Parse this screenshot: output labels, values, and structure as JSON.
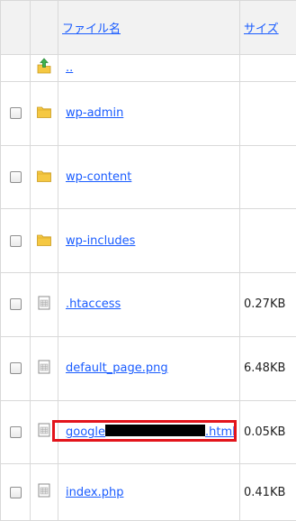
{
  "table": {
    "header": {
      "filename_label": "ファイル名",
      "size_label": "サイズ"
    },
    "up_link": "..",
    "rows": [
      {
        "name": "wp-admin",
        "type": "folder",
        "size": ""
      },
      {
        "name": "wp-content",
        "type": "folder",
        "size": ""
      },
      {
        "name": "wp-includes",
        "type": "folder",
        "size": ""
      },
      {
        "name": ".htaccess",
        "type": "file",
        "size": "0.27KB"
      },
      {
        "name": "default_page.png",
        "type": "file",
        "size": "6.48KB"
      },
      {
        "name_prefix": "google",
        "name_suffix": ".html",
        "type": "file",
        "size": "0.05KB",
        "highlighted": true
      },
      {
        "name": "index.php",
        "type": "file",
        "size": "0.41KB"
      }
    ]
  },
  "icons": {
    "up": "up-arrow-folder-icon",
    "folder": "folder-icon",
    "file": "file-icon"
  },
  "colors": {
    "link": "#1a5cff",
    "header_bg": "#f2f2f2",
    "folder": "#f5c842",
    "highlight": "#e3141b",
    "redaction": "#000000"
  }
}
